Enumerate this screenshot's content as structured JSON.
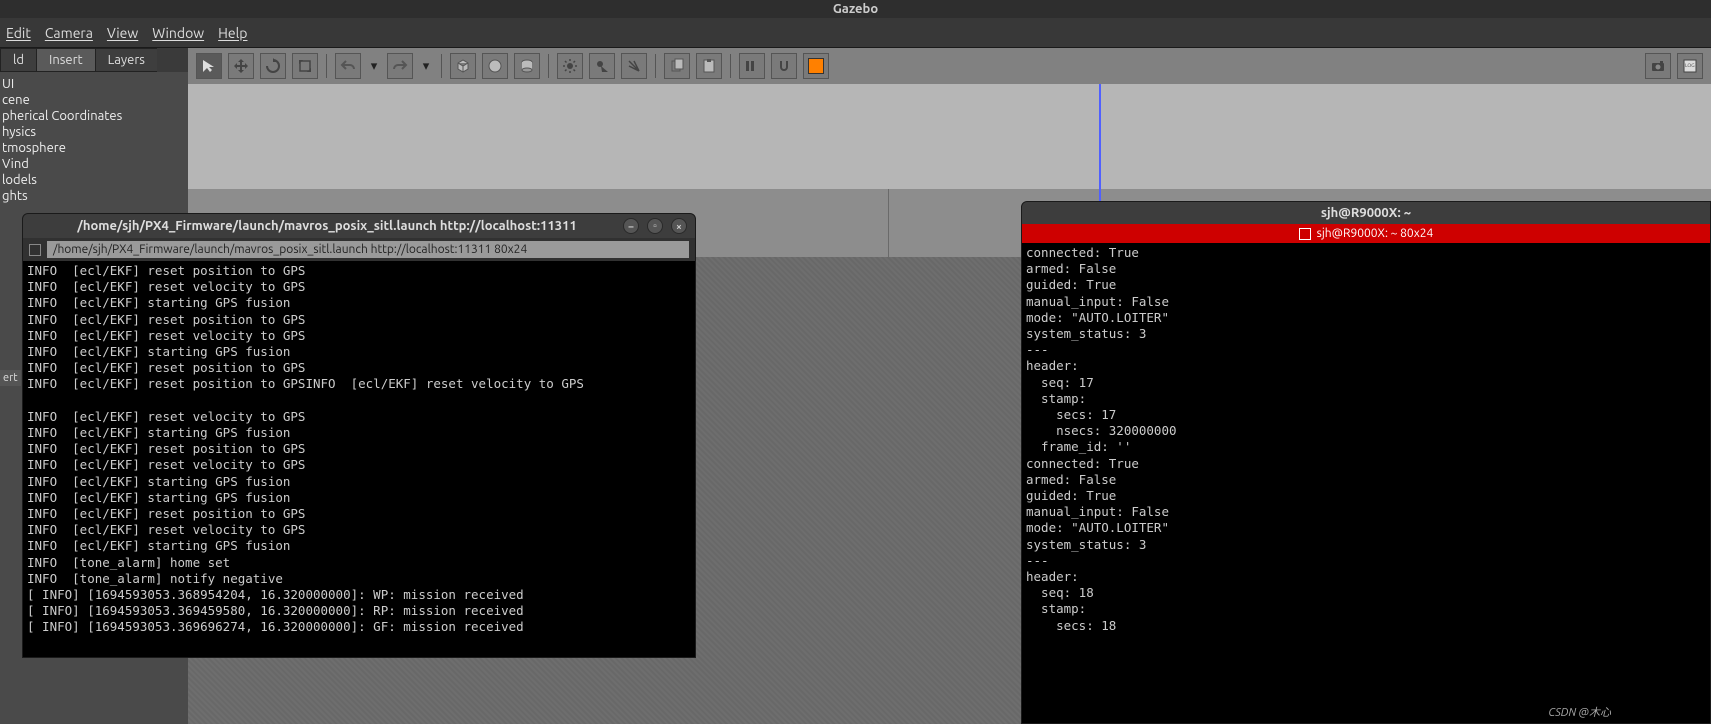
{
  "app": {
    "title": "Gazebo"
  },
  "menu": {
    "edit": "Edit",
    "camera": "Camera",
    "view": "View",
    "window": "Window",
    "help": "Help"
  },
  "sidebar": {
    "tabs": {
      "world": "ld",
      "insert": "Insert",
      "layers": "Layers"
    },
    "tree": {
      "gui": "UI",
      "scene": "cene",
      "sph": "pherical Coordinates",
      "phys": "hysics",
      "atm": "tmosphere",
      "wind": "Vind",
      "models": "lodels",
      "lights": "ghts"
    }
  },
  "side_tab_label": "ert",
  "terminal1": {
    "title": "/home/sjh/PX4_Firmware/launch/mavros_posix_sitl.launch http://localhost:11311",
    "tab": "/home/sjh/PX4_Firmware/launch/mavros_posix_sitl.launch http://localhost:11311 80x24",
    "lines": "INFO  [ecl/EKF] reset position to GPS\nINFO  [ecl/EKF] reset velocity to GPS\nINFO  [ecl/EKF] starting GPS fusion\nINFO  [ecl/EKF] reset position to GPS\nINFO  [ecl/EKF] reset velocity to GPS\nINFO  [ecl/EKF] starting GPS fusion\nINFO  [ecl/EKF] reset position to GPS\nINFO  [ecl/EKF] reset position to GPSINFO  [ecl/EKF] reset velocity to GPS\n\nINFO  [ecl/EKF] reset velocity to GPS\nINFO  [ecl/EKF] starting GPS fusion\nINFO  [ecl/EKF] reset position to GPS\nINFO  [ecl/EKF] reset velocity to GPS\nINFO  [ecl/EKF] starting GPS fusion\nINFO  [ecl/EKF] starting GPS fusion\nINFO  [ecl/EKF] reset position to GPS\nINFO  [ecl/EKF] reset velocity to GPS\nINFO  [ecl/EKF] starting GPS fusion\nINFO  [tone_alarm] home set\nINFO  [tone_alarm] notify negative\n[ INFO] [1694593053.368954204, 16.320000000]: WP: mission received\n[ INFO] [1694593053.369459580, 16.320000000]: RP: mission received\n[ INFO] [1694593053.369696274, 16.320000000]: GF: mission received"
  },
  "terminal2": {
    "title": "sjh@R9000X: ~",
    "tab": "sjh@R9000X: ~ 80x24",
    "lines": "connected: True\narmed: False\nguided: True\nmanual_input: False\nmode: \"AUTO.LOITER\"\nsystem_status: 3\n---\nheader:\n  seq: 17\n  stamp:\n    secs: 17\n    nsecs: 320000000\n  frame_id: ''\nconnected: True\narmed: False\nguided: True\nmanual_input: False\nmode: \"AUTO.LOITER\"\nsystem_status: 3\n---\nheader:\n  seq: 18\n  stamp:\n    secs: 18"
  },
  "watermark": "CSDN @木心"
}
